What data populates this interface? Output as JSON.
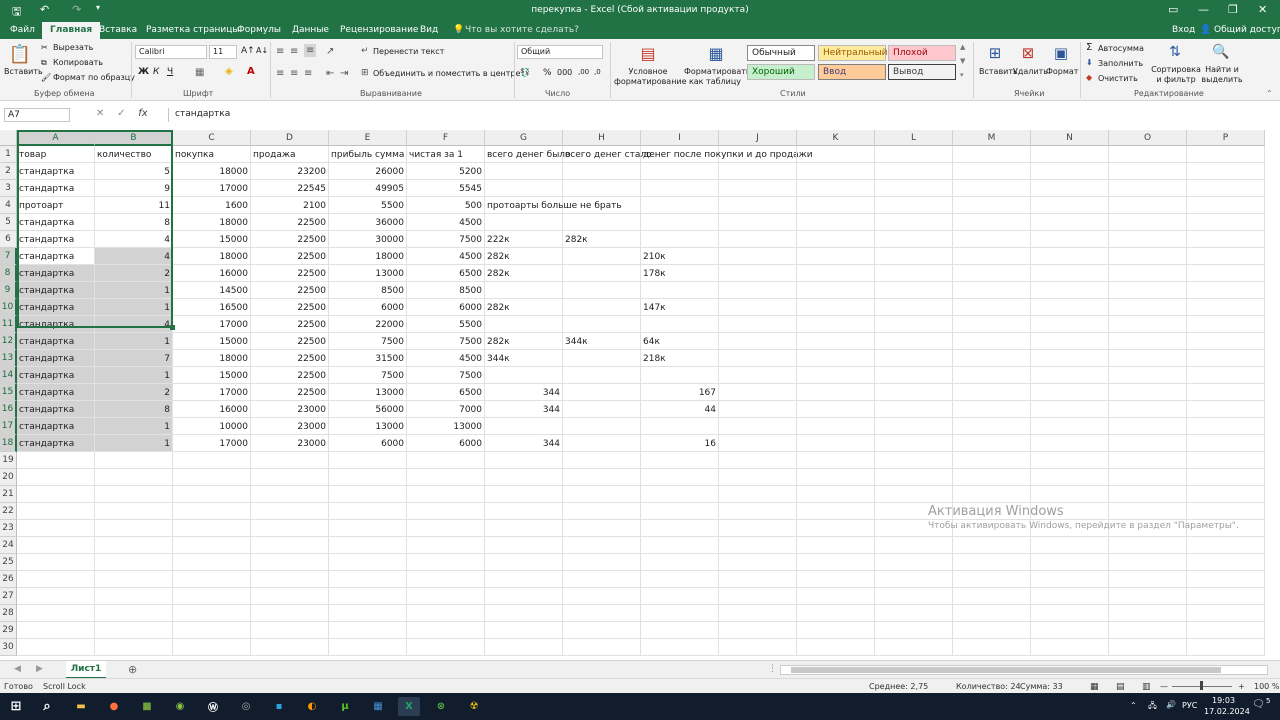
{
  "window": {
    "title": "перекупка - Excel (Сбой активации продукта)"
  },
  "ribbon_tabs": [
    "Файл",
    "Главная",
    "Вставка",
    "Разметка страницы",
    "Формулы",
    "Данные",
    "Рецензирование",
    "Вид"
  ],
  "tell_me": "Что вы хотите сделать?",
  "account": {
    "signin": "Вход",
    "share": "Общий доступ"
  },
  "clipboard": {
    "paste": "Вставить",
    "cut": "Вырезать",
    "copy": "Копировать",
    "format_painter": "Формат по образцу",
    "group": "Буфер обмена"
  },
  "font": {
    "name": "Calibri",
    "size": "11",
    "group": "Шрифт"
  },
  "alignment": {
    "wrap": "Перенести текст",
    "merge": "Объединить и поместить в центре",
    "group": "Выравнивание"
  },
  "number": {
    "format": "Общий",
    "group": "Число"
  },
  "styles": {
    "conditional": "Условное форматирование",
    "as_table": "Форматировать как таблицу",
    "normal": "Обычный",
    "neutral": "Нейтральный",
    "bad": "Плохой",
    "good": "Хороший",
    "input": "Ввод",
    "output": "Вывод",
    "group": "Стили"
  },
  "cells": {
    "insert": "Вставить",
    "delete": "Удалить",
    "format": "Формат",
    "group": "Ячейки"
  },
  "editing": {
    "autosum": "Автосумма",
    "fill": "Заполнить",
    "clear": "Очистить",
    "sort": "Сортировка и фильтр",
    "find": "Найти и выделить",
    "group": "Редактирование"
  },
  "formula_bar": {
    "name_box": "A7",
    "value": "стандартка"
  },
  "columns": [
    "A",
    "B",
    "C",
    "D",
    "E",
    "F",
    "G",
    "H",
    "I",
    "J",
    "K",
    "L",
    "M",
    "N",
    "O",
    "P"
  ],
  "row_numbers": [
    "1",
    "2",
    "3",
    "4",
    "5",
    "6",
    "7",
    "8",
    "9",
    "10",
    "11",
    "12",
    "13",
    "14",
    "15",
    "16",
    "17",
    "18",
    "19",
    "20",
    "21",
    "22",
    "23",
    "24",
    "25",
    "26",
    "27",
    "28",
    "29",
    "30"
  ],
  "rows": [
    [
      "товар",
      "количество",
      "покупка",
      "продажа",
      "прибыль сумма",
      "чистая за 1",
      "всего денег было",
      "всего денег стало",
      "денег после покупки и до продажи"
    ],
    [
      "стандартка",
      "5",
      "18000",
      "23200",
      "26000",
      "5200",
      "",
      "",
      ""
    ],
    [
      "стандартка",
      "9",
      "17000",
      "22545",
      "49905",
      "5545",
      "",
      "",
      ""
    ],
    [
      "протоарт",
      "11",
      "1600",
      "2100",
      "5500",
      "500",
      "протоарты больше не брать",
      "",
      ""
    ],
    [
      "стандартка",
      "8",
      "18000",
      "22500",
      "36000",
      "4500",
      "",
      "",
      ""
    ],
    [
      "стандартка",
      "4",
      "15000",
      "22500",
      "30000",
      "7500",
      "222к",
      "282к",
      ""
    ],
    [
      "стандартка",
      "4",
      "18000",
      "22500",
      "18000",
      "4500",
      "282к",
      "",
      "210к"
    ],
    [
      "стандартка",
      "2",
      "16000",
      "22500",
      "13000",
      "6500",
      "282к",
      "",
      "178к"
    ],
    [
      "стандартка",
      "1",
      "14500",
      "22500",
      "8500",
      "8500",
      "",
      "",
      ""
    ],
    [
      "стандартка",
      "1",
      "16500",
      "22500",
      "6000",
      "6000",
      "282к",
      "",
      "147к"
    ],
    [
      "стандартка",
      "4",
      "17000",
      "22500",
      "22000",
      "5500",
      "",
      "",
      ""
    ],
    [
      "стандартка",
      "1",
      "15000",
      "22500",
      "7500",
      "7500",
      "282к",
      "344к",
      "64к"
    ],
    [
      "стандартка",
      "7",
      "18000",
      "22500",
      "31500",
      "4500",
      "344к",
      "",
      "218к"
    ],
    [
      "стандартка",
      "1",
      "15000",
      "22500",
      "7500",
      "7500",
      "",
      "",
      ""
    ],
    [
      "стандартка",
      "2",
      "17000",
      "22500",
      "13000",
      "6500",
      "344",
      "",
      "167"
    ],
    [
      "стандартка",
      "8",
      "16000",
      "23000",
      "56000",
      "7000",
      "344",
      "",
      "44"
    ],
    [
      "стандартка",
      "1",
      "10000",
      "23000",
      "13000",
      "13000",
      "",
      "",
      ""
    ],
    [
      "стандартка",
      "1",
      "17000",
      "23000",
      "6000",
      "6000",
      "344",
      "",
      "16"
    ]
  ],
  "sheet": {
    "name": "Лист1"
  },
  "activation": {
    "title": "Активация Windows",
    "text": "Чтобы активировать Windows, перейдите в раздел \"Параметры\"."
  },
  "status": {
    "ready": "Готово",
    "scroll_lock": "Scroll Lock",
    "average": "Среднее: 2,75",
    "count": "Количество: 24",
    "sum": "Сумма: 33",
    "zoom": "100 %"
  },
  "taskbar": {
    "lang": "РУС",
    "time": "19:03",
    "date": "17.02.2024",
    "notif": "5"
  },
  "colors": {
    "excel_green": "#217346",
    "selection": "#d2d2d2",
    "taskbar": "#111c2c"
  }
}
